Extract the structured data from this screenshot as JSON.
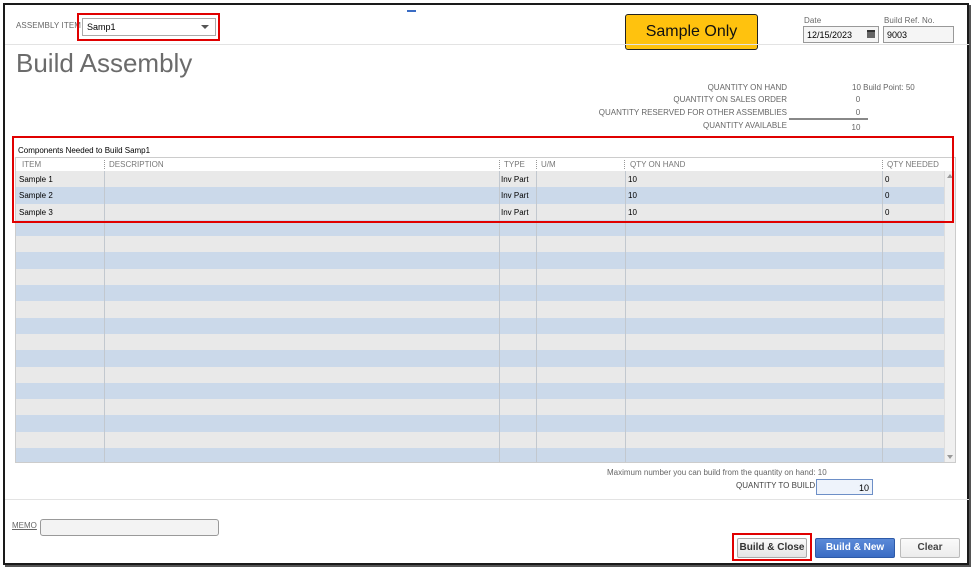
{
  "header": {
    "assembly_item_label": "ASSEMBLY ITEM",
    "assembly_item_value": "Samp1",
    "sample_badge": "Sample Only",
    "date_label": "Date",
    "date_value": "12/15/2023",
    "build_ref_label": "Build Ref. No.",
    "build_ref_value": "9003"
  },
  "title": "Build Assembly",
  "quantities": {
    "on_hand_label": "QUANTITY ON HAND",
    "on_hand_value": "10  Build Point: 50",
    "on_sales_order_label": "QUANTITY ON SALES ORDER",
    "on_sales_order_value": "0",
    "reserved_label": "QUANTITY RESERVED FOR OTHER ASSEMBLIES",
    "reserved_value": "0",
    "available_label": "QUANTITY AVAILABLE",
    "available_value": "10"
  },
  "components": {
    "heading": "Components Needed to Build  Samp1",
    "columns": [
      "ITEM",
      "DESCRIPTION",
      "TYPE",
      "U/M",
      "QTY ON HAND",
      "QTY NEEDED"
    ],
    "rows": [
      {
        "item": "Sample 1",
        "description": "",
        "type": "Inv Part",
        "um": "",
        "qty_on_hand": "10",
        "qty_needed": "0"
      },
      {
        "item": "Sample 2",
        "description": "",
        "type": "Inv Part",
        "um": "",
        "qty_on_hand": "10",
        "qty_needed": "0"
      },
      {
        "item": "Sample 3",
        "description": "",
        "type": "Inv Part",
        "um": "",
        "qty_on_hand": "10",
        "qty_needed": "0"
      }
    ]
  },
  "footer": {
    "max_build_text": "Maximum number you can build from the quantity on hand: 10",
    "quantity_to_build_label": "QUANTITY TO BUILD",
    "quantity_to_build_value": "10",
    "memo_label": "MEMO",
    "memo_value": ""
  },
  "buttons": {
    "build_close": "Build & Close",
    "build_new": "Build & New",
    "clear": "Clear"
  },
  "colors": {
    "sample_badge_bg": "#ffc20e",
    "highlight_red": "#e00000",
    "row_blue": "#cbd9ea",
    "row_gray": "#e9e9e9",
    "primary_button": "#3a6cc4"
  }
}
